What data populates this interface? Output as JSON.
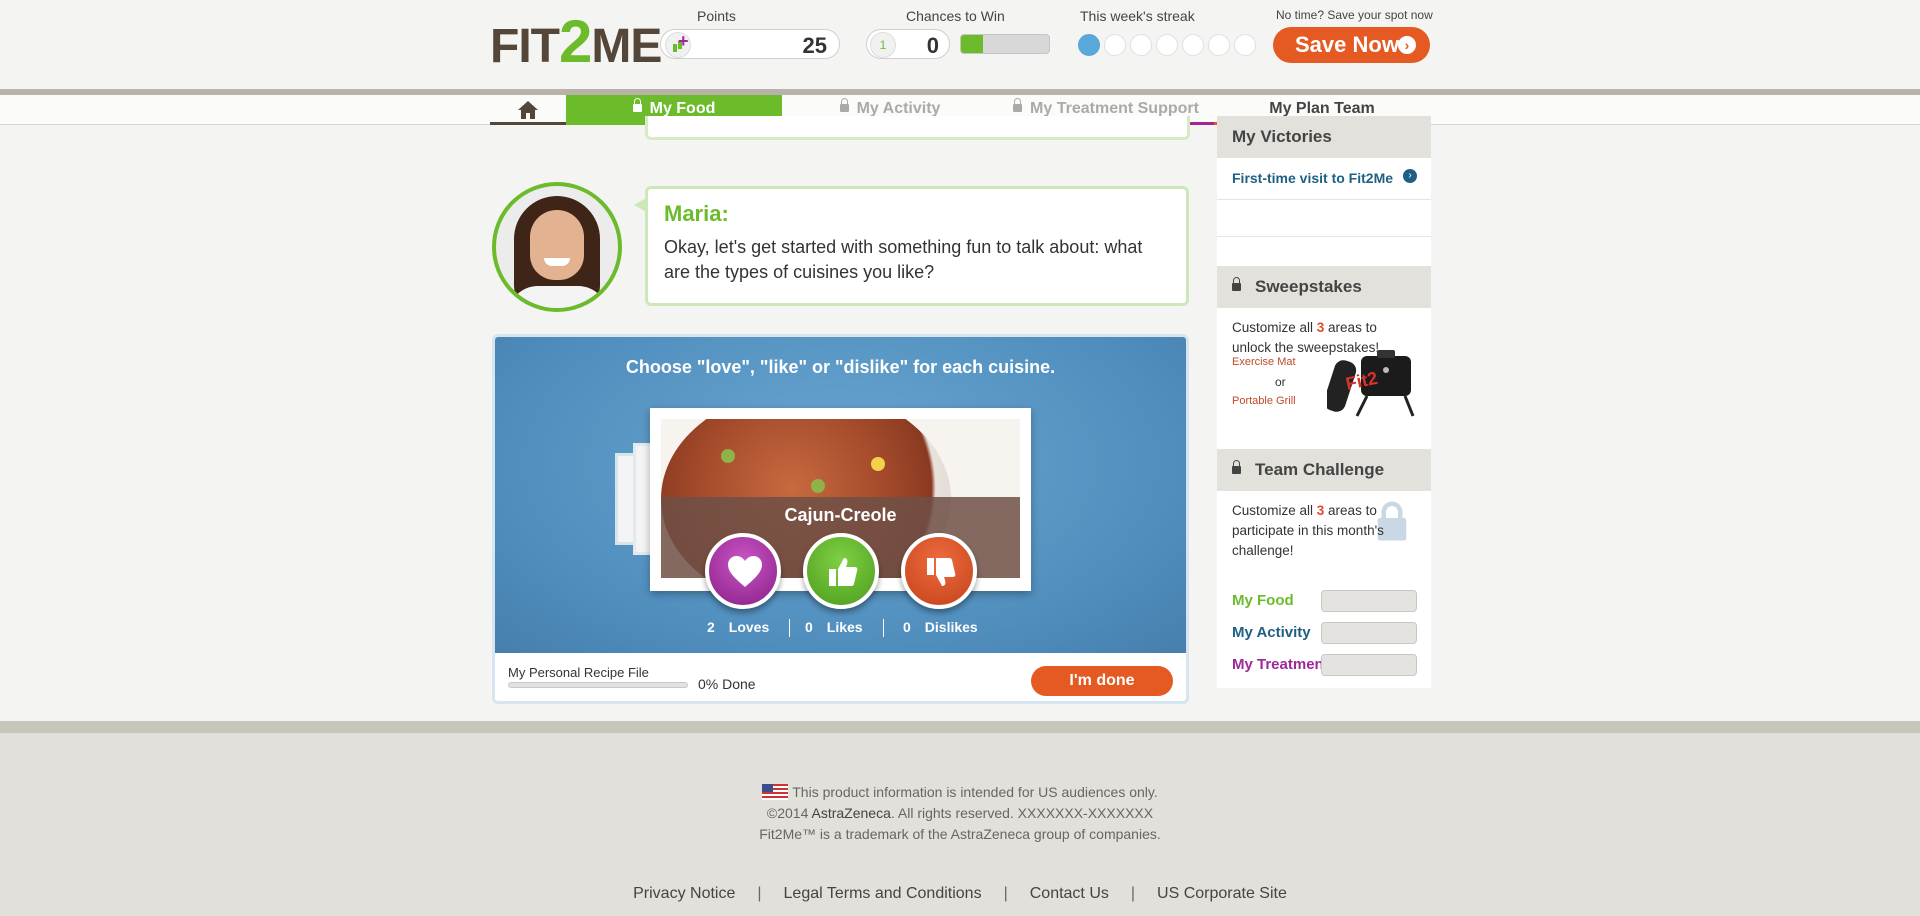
{
  "header": {
    "logo": {
      "pre": "FIT",
      "mid": "2",
      "post": "ME"
    },
    "points": {
      "label": "Points",
      "value": "25"
    },
    "chances": {
      "label": "Chances to Win",
      "value": "0",
      "badge": "1",
      "progress_fraction": 0.25
    },
    "streak": {
      "label": "This week's streak",
      "days_total": 7,
      "days_done": 1
    },
    "save": {
      "prompt": "No time? Save your spot now",
      "button": "Save Now"
    }
  },
  "nav": {
    "home_icon": "home-icon",
    "items": [
      {
        "label": "My Food",
        "locked": true,
        "active": true
      },
      {
        "label": "My Activity",
        "locked": true,
        "active": false
      },
      {
        "label": "My Treatment Support",
        "locked": true,
        "active": false
      },
      {
        "label": "My Plan Team",
        "locked": false,
        "active": false
      }
    ]
  },
  "chat": {
    "name": "Maria:",
    "message": "Okay, let's get started with something fun to talk about: what are the types of cuisines you like?"
  },
  "cuisine": {
    "instruction": "Choose \"love\", \"like\" or \"dislike\" for each cuisine.",
    "current": "Cajun-Creole",
    "loves_count": "2",
    "loves_label": "Loves",
    "likes_count": "0",
    "likes_label": "Likes",
    "dislikes_count": "0",
    "dislikes_label": "Dislikes"
  },
  "recipe": {
    "label": "My Personal Recipe File",
    "percent_text": "0% Done",
    "progress_fraction": 0.0
  },
  "done_button": "I'm done",
  "sidebar": {
    "victories": {
      "title": "My Victories",
      "link": "First-time visit to Fit2Me"
    },
    "sweepstakes": {
      "title": "Sweepstakes",
      "text_pre": "Customize all ",
      "text_num": "3",
      "text_post": " areas to unlock the sweepstakes!",
      "prize1": "Exercise Mat",
      "or": "or",
      "prize2": "Portable Grill"
    },
    "team": {
      "title": "Team Challenge",
      "text_pre": "Customize all ",
      "text_num": "3",
      "text_post": " areas to participate in this month's challenge!",
      "rows": [
        {
          "label": "My Food",
          "color": "#6cbb2b"
        },
        {
          "label": "My Activity",
          "color": "#1f5f86"
        },
        {
          "label": "My Treatment",
          "color": "#a0279a"
        }
      ]
    }
  },
  "footer": {
    "line1": "This product information is intended for US audiences only.",
    "line2_pre": "©2014 ",
    "line2_brand": "AstraZeneca",
    "line2_post": ". All rights reserved. XXXXXXX-XXXXXXX",
    "line3": "Fit2Me™ is a trademark of the AstraZeneca group of companies.",
    "links": [
      "Privacy Notice",
      "Legal Terms and Conditions",
      "Contact Us",
      "US Corporate Site"
    ]
  },
  "colors": {
    "brand_green": "#6cbb2b",
    "accent_orange": "#e55a22",
    "activity_blue": "#1f5f86",
    "treatment_purple": "#a0279a"
  }
}
